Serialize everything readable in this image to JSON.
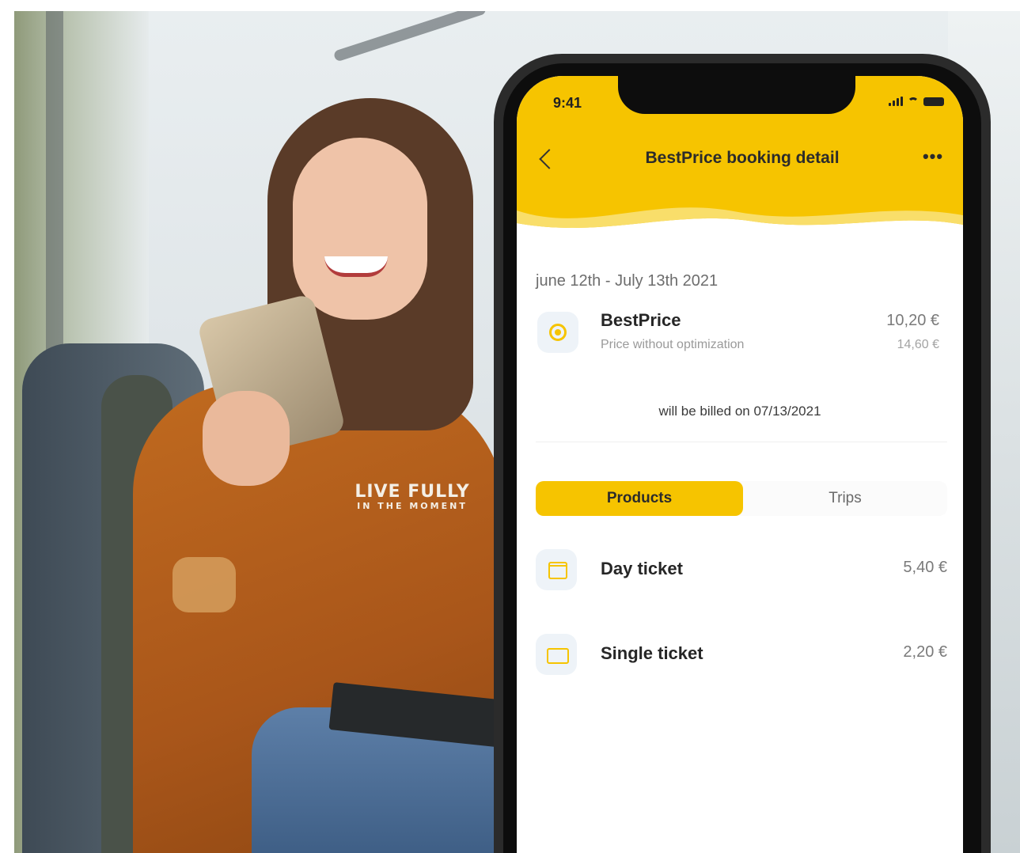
{
  "photo": {
    "shirt_text_line1": "LIVE FULLY",
    "shirt_text_line2": "IN THE MOMENT"
  },
  "status_bar": {
    "time": "9:41",
    "icons": [
      "signal-icon",
      "wifi-icon",
      "battery-icon"
    ]
  },
  "header": {
    "title": "BestPrice booking detail",
    "back_icon": "chevron-left-icon",
    "more_label": "•••",
    "color": "#f6c400"
  },
  "summary": {
    "period": "june 12th - July 13th 2021",
    "name": "BestPrice",
    "price": "10,20 €",
    "subtitle": "Price without optimization",
    "original_price": "14,60 €",
    "billed_note": "will be billed on 07/13/2021"
  },
  "tabs": [
    {
      "label": "Products",
      "active": true
    },
    {
      "label": "Trips",
      "active": false
    }
  ],
  "products": [
    {
      "name": "Day ticket",
      "price": "5,40 €",
      "icon": "calendar-icon"
    },
    {
      "name": "Single ticket",
      "price": "2,20 €",
      "icon": "ticket-icon"
    }
  ]
}
